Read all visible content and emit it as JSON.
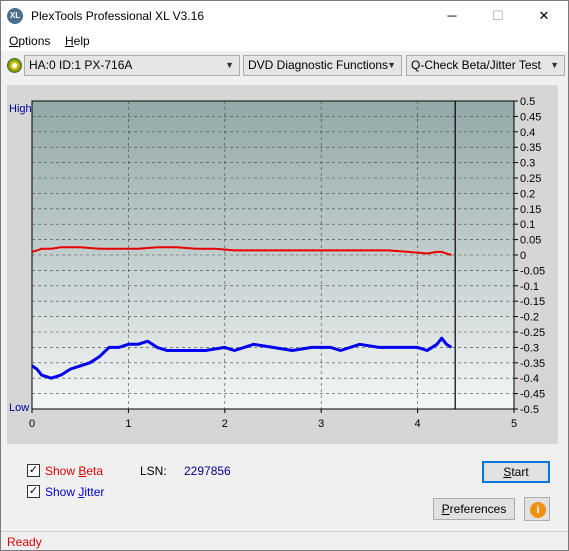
{
  "window": {
    "app_icon": "XL",
    "title": "PlexTools Professional XL V3.16",
    "minimize_glyph": "─",
    "maximize_glyph": "☐",
    "close_glyph": "✕"
  },
  "menu": {
    "options_first": "O",
    "options_rest": "ptions",
    "help_first": "H",
    "help_rest": "elp"
  },
  "toolbar": {
    "drive_icon": "disc-icon",
    "drive": "HA:0 ID:1  PX-716A",
    "function": "DVD Diagnostic Functions",
    "test": "Q-Check Beta/Jitter Test",
    "arrow_glyph": "▼"
  },
  "chart_data": {
    "type": "line",
    "left_top_label": "High",
    "left_bottom_label": "Low",
    "x_ticks": [
      "0",
      "1",
      "2",
      "3",
      "4",
      "5"
    ],
    "y_ticks": [
      "0.5",
      "0.45",
      "0.4",
      "0.35",
      "0.3",
      "0.25",
      "0.2",
      "0.15",
      "0.1",
      "0.05",
      "0",
      "-0.05",
      "-0.1",
      "-0.15",
      "-0.2",
      "-0.25",
      "-0.3",
      "-0.35",
      "-0.4",
      "-0.45",
      "-0.5"
    ],
    "xlim": [
      0,
      5
    ],
    "ylim": [
      -0.5,
      0.5
    ],
    "end_marker_x": 4.39,
    "grid": true,
    "colors": {
      "beta": "#e60000",
      "jitter": "#0000ee",
      "marker": "#000000"
    },
    "series": [
      {
        "name": "Beta",
        "x": [
          0,
          0.05,
          0.1,
          0.2,
          0.3,
          0.5,
          0.7,
          0.9,
          1.1,
          1.3,
          1.5,
          1.7,
          1.9,
          2.1,
          2.3,
          2.5,
          2.7,
          2.9,
          3.1,
          3.3,
          3.5,
          3.7,
          3.9,
          4.1,
          4.2,
          4.25,
          4.3,
          4.35
        ],
        "values": [
          0.01,
          0.015,
          0.02,
          0.02,
          0.025,
          0.025,
          0.02,
          0.02,
          0.02,
          0.025,
          0.025,
          0.02,
          0.02,
          0.015,
          0.015,
          0.015,
          0.015,
          0.015,
          0.015,
          0.015,
          0.015,
          0.015,
          0.01,
          0.005,
          0.01,
          0.01,
          0.005,
          0.0
        ]
      },
      {
        "name": "Jitter",
        "x": [
          0,
          0.05,
          0.1,
          0.2,
          0.3,
          0.4,
          0.5,
          0.6,
          0.7,
          0.8,
          0.9,
          1.0,
          1.1,
          1.2,
          1.3,
          1.4,
          1.6,
          1.8,
          2.0,
          2.1,
          2.2,
          2.3,
          2.5,
          2.7,
          2.9,
          3.1,
          3.2,
          3.3,
          3.4,
          3.6,
          3.8,
          4.0,
          4.1,
          4.2,
          4.25,
          4.3,
          4.35
        ],
        "values": [
          -0.36,
          -0.37,
          -0.39,
          -0.4,
          -0.39,
          -0.37,
          -0.36,
          -0.35,
          -0.33,
          -0.3,
          -0.3,
          -0.29,
          -0.29,
          -0.28,
          -0.3,
          -0.31,
          -0.31,
          -0.31,
          -0.3,
          -0.31,
          -0.3,
          -0.29,
          -0.3,
          -0.31,
          -0.3,
          -0.3,
          -0.31,
          -0.3,
          -0.29,
          -0.3,
          -0.3,
          -0.3,
          -0.31,
          -0.29,
          -0.27,
          -0.29,
          -0.3
        ]
      }
    ]
  },
  "options": {
    "show_beta_first": "Show ",
    "show_beta_key": "B",
    "show_beta_rest": "eta",
    "show_jitter_first": "Show ",
    "show_jitter_key": "J",
    "show_jitter_rest": "itter",
    "check_glyph": "✓",
    "show_beta_checked": true,
    "show_jitter_checked": true,
    "lsn_label": "LSN:",
    "lsn_value": "2297856"
  },
  "buttons": {
    "start_key": "S",
    "start_rest": "tart",
    "prefs_key": "P",
    "prefs_rest": "references",
    "info_glyph": "i"
  },
  "status": {
    "text": "Ready"
  }
}
